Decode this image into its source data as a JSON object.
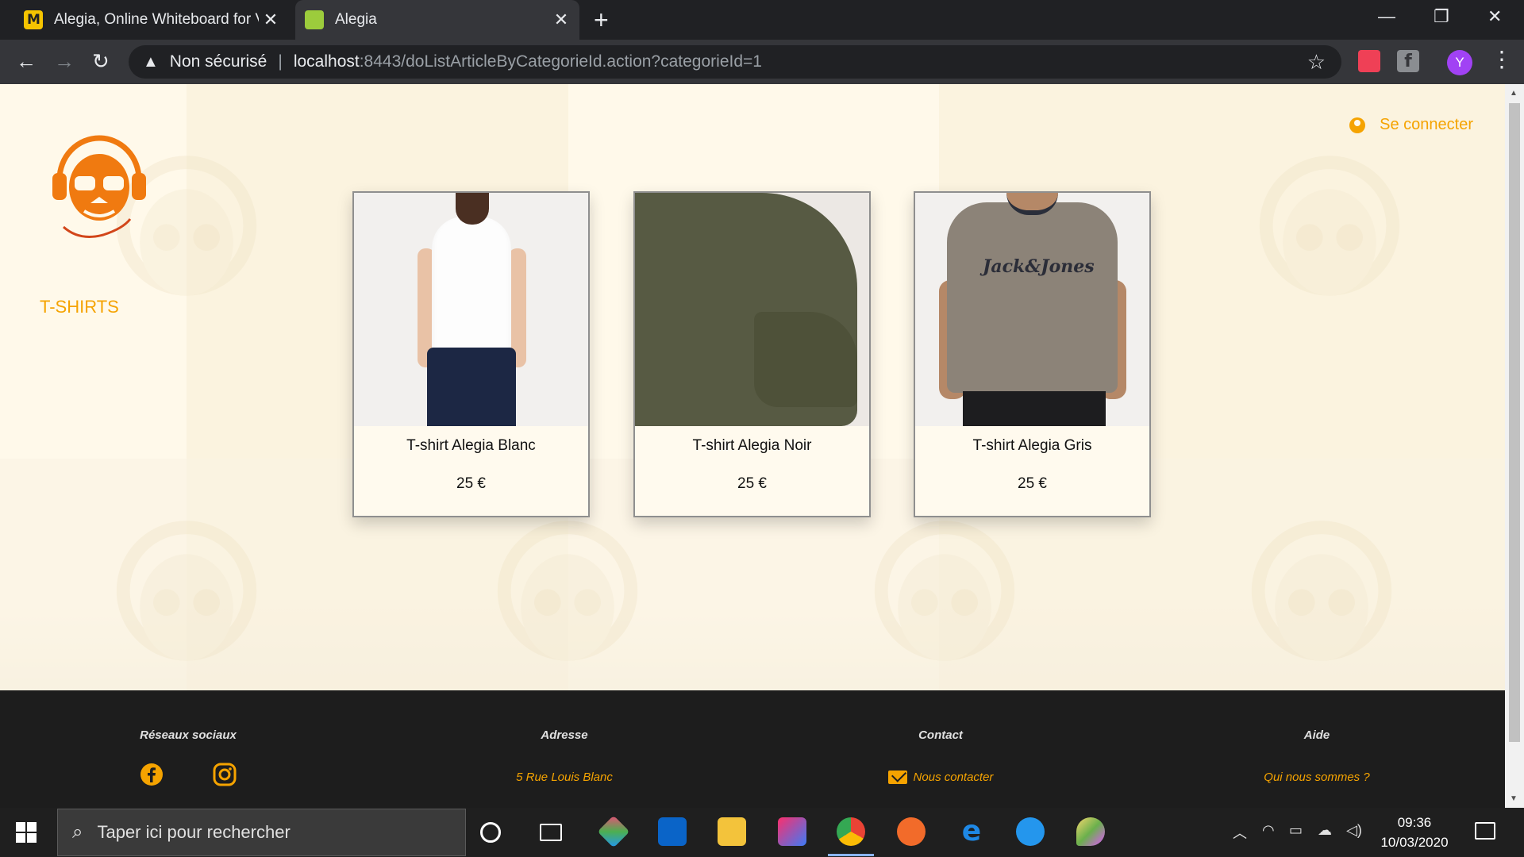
{
  "browser": {
    "tabs": [
      {
        "title": "Alegia, Online Whiteboard for Vi",
        "icon": "miro-favicon",
        "active": false
      },
      {
        "title": "Alegia",
        "icon": "leaf-favicon",
        "active": true
      }
    ],
    "close_glyph": "✕",
    "new_tab_glyph": "+",
    "window": {
      "minimize": "—",
      "restore": "❐",
      "close": "✕"
    },
    "nav": {
      "back": "←",
      "forward": "→",
      "reload": "↻"
    },
    "address": {
      "security_label": "Non sécurisé",
      "separator": "|",
      "host": "localhost",
      "path": ":8443/doListArticleByCategorieId.action?categorieId=1"
    },
    "star_glyph": "☆",
    "profile_initial": "Y",
    "menu_glyph": "⋮"
  },
  "page": {
    "sidebar": {
      "category": "T-SHIRTS"
    },
    "header": {
      "login_label": "Se connecter"
    },
    "products": [
      {
        "name": "T-shirt Alegia Blanc",
        "price": "25 €"
      },
      {
        "name": "T-shirt Alegia Noir",
        "price": "25 €"
      },
      {
        "name": "T-shirt Alegia Gris",
        "price": "25 €",
        "print_text": "Jack&Jones"
      }
    ],
    "footer": {
      "social": {
        "heading": "Réseaux sociaux",
        "icons": [
          "facebook-icon",
          "instagram-icon"
        ]
      },
      "address": {
        "heading": "Adresse",
        "value": "5 Rue Louis Blanc"
      },
      "contact": {
        "heading": "Contact",
        "link": "Nous contacter"
      },
      "help": {
        "heading": "Aide",
        "link": "Qui nous sommes ?"
      }
    },
    "colors": {
      "accent": "#f5a300",
      "footer_bg": "#1d1d1d",
      "page_bg": "#fff9ea"
    }
  },
  "taskbar": {
    "search_placeholder": "Taper ici pour rechercher",
    "clock_time": "09:36",
    "clock_date": "10/03/2020"
  }
}
